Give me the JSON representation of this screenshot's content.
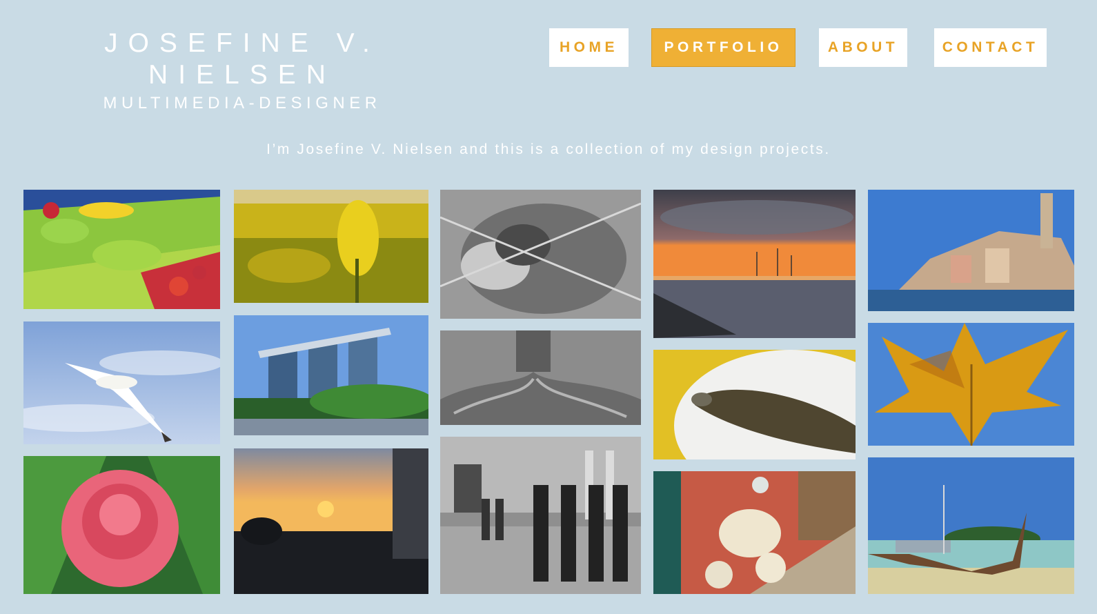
{
  "header": {
    "name": "JOSEFINE V. NIELSEN",
    "role": "MULTIMEDIA-DESIGNER"
  },
  "nav": {
    "items": [
      {
        "label": "HOME"
      },
      {
        "label": "PORTFOLIO",
        "active": true
      },
      {
        "label": "ABOUT"
      },
      {
        "label": "CONTACT"
      }
    ]
  },
  "intro": "I’m Josefine V. Nielsen and this is a collection of my design projects.",
  "colors": {
    "background": "#c9dbe5",
    "accent": "#efb035",
    "accent_text": "#e8a326"
  },
  "gallery": {
    "items": [
      "fruit-market-photo",
      "seagull-photo",
      "pink-flower-photo",
      "rapeseed-field-photo",
      "marina-bay-hotel-photo",
      "seaside-sunset-photo",
      "donkey-fence-photo",
      "tree-roots-photo",
      "royal-guards-photo",
      "harbour-sunset-photo",
      "grilled-fish-photo",
      "scooter-street-photo",
      "coastal-town-photo",
      "autumn-leaf-photo",
      "longtail-boat-photo"
    ]
  }
}
